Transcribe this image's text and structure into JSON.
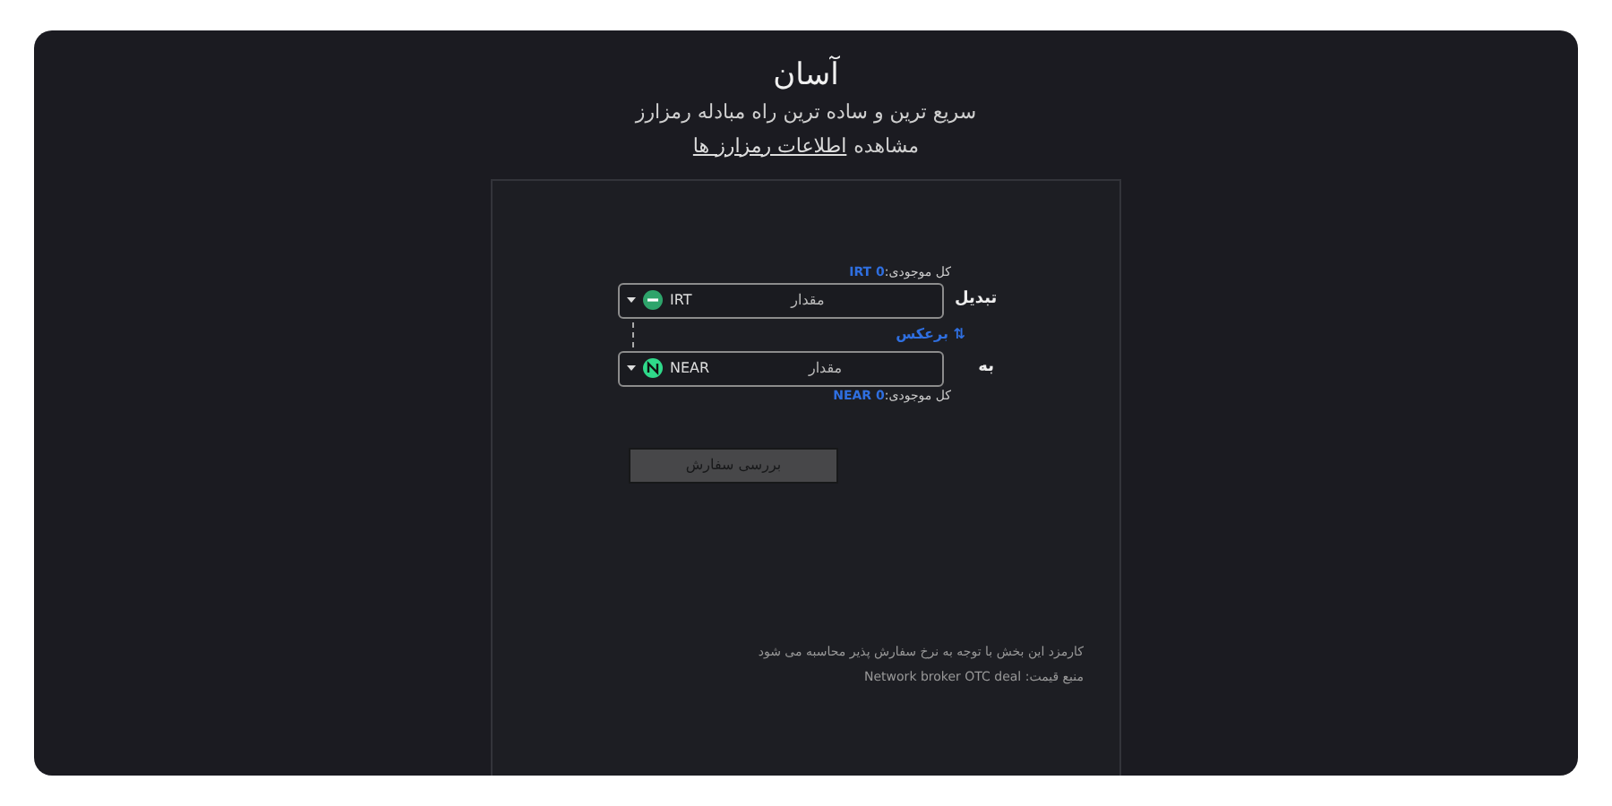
{
  "header": {
    "title": "آسان",
    "subtitle": "سریع ترین و ساده ترین راه مبادله رمزارز",
    "info_prefix": "مشاهده",
    "info_link": "اطلاعات رمزارز ها"
  },
  "fields": [
    {
      "label": "تبدیل",
      "currency": "IRT",
      "placeholder": "مقدار",
      "balance_label": "کل موجودی:",
      "balance_value": "IRT 0",
      "kind": "source"
    },
    {
      "label": "به",
      "currency": "NEAR",
      "placeholder": "مقدار",
      "balance_label": "کل موجودی:",
      "balance_value": "NEAR 0",
      "kind": "target"
    }
  ],
  "swap": {
    "label": "برعکس",
    "icon": "⇅"
  },
  "submit": {
    "label": "بررسی سفارش",
    "disabled": true
  },
  "notes": [
    "کارمزد این بخش با توجه به نرخ سفارش پذیر محاسبه می شود",
    "منبع قیمت: Network broker OTC deal"
  ]
}
